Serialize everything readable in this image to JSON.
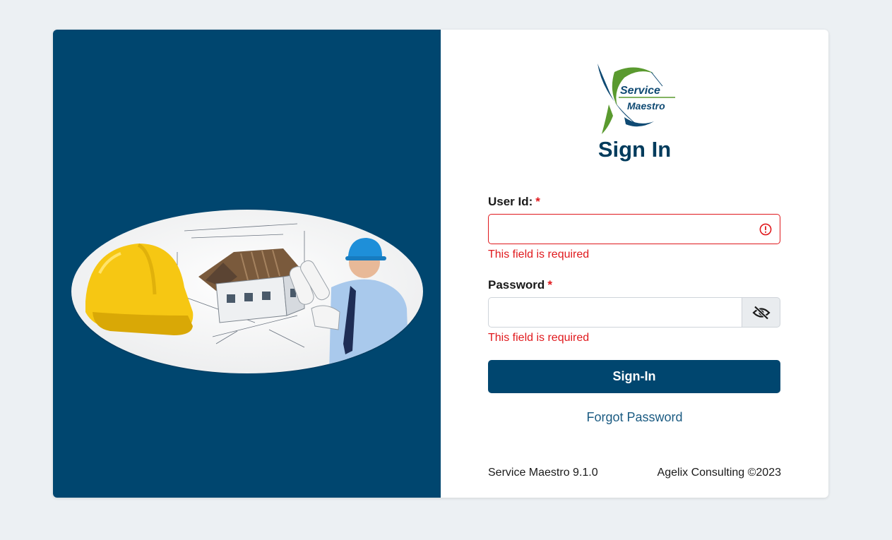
{
  "brand": {
    "logo_line1": "Service",
    "logo_line2": "Maestro"
  },
  "signin": {
    "title": "Sign In",
    "user_id_label": "User Id:",
    "user_id_value": "",
    "user_id_error": "This field is required",
    "password_label": "Password",
    "password_value": "",
    "password_error": "This field is required",
    "required_mark": "*",
    "submit_label": "Sign-In",
    "forgot_label": "Forgot Password"
  },
  "footer": {
    "version": "Service Maestro 9.1.0",
    "copyright": "Agelix Consulting ©2023"
  },
  "icons": {
    "error": "error-circle-icon",
    "toggle_password": "eye-slash-icon"
  },
  "colors": {
    "primary": "#00466f",
    "title": "#003b5c",
    "error": "#e0191d",
    "link": "#1b5b82",
    "logo_green": "#5a9a2f",
    "background": "#ecf0f3"
  }
}
